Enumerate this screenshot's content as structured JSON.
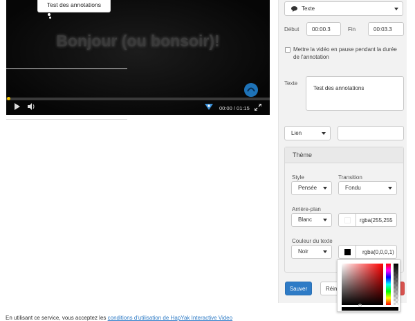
{
  "player": {
    "annotation_text": "Test des annotations",
    "video_text": "Bonjour (ou bonsoir)!",
    "time": "00:00 / 01:15",
    "progress": 0.0,
    "icons": [
      "play-icon",
      "volume-icon",
      "hapyak-icon",
      "fullscreen-icon"
    ]
  },
  "panel": {
    "type_select": {
      "icon": "speech-bubble-icon",
      "value": "Texte"
    },
    "start_label": "Début",
    "start_value": "00:00.3",
    "end_label": "Fin",
    "end_value": "00:03.3",
    "pause_checkbox_label": "Mettre la vidéo en pause pendant la durée de l'annotation",
    "pause_checked": false,
    "text_label": "Texte",
    "text_value": "Test des annotations",
    "link_select": "Lien",
    "link_value": "",
    "theme": {
      "title": "Thème",
      "style_label": "Style",
      "style_value": "Pensée",
      "transition_label": "Transition",
      "transition_value": "Fondu",
      "background_label": "Arrière-plan",
      "background_value": "Blanc",
      "background_rgba": "rgba(255,255",
      "background_color": "#ffffff",
      "text_color_label": "Couleur du texte",
      "text_color_value": "Noir",
      "text_color_rgba": "rgba(0,0,0,1)",
      "text_color": "#000000"
    },
    "save_button": "Sauver",
    "reset_button": "Réinit"
  },
  "footer": {
    "text": "En utilisant ce service, vous acceptez les ",
    "link": "conditions d'utilisation de HapYak Interactive Video"
  },
  "colors": {
    "accent": "#2e7bc6",
    "danger": "#d9534f"
  }
}
